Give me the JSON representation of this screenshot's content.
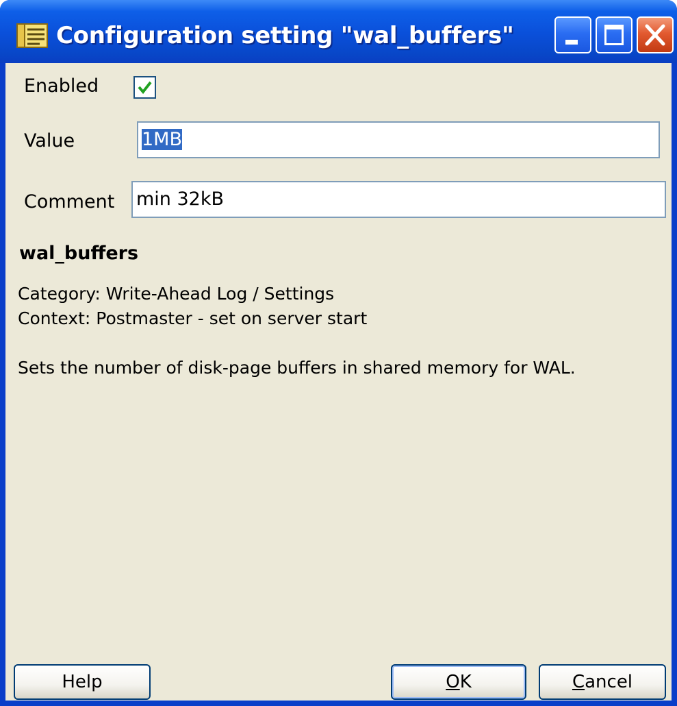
{
  "window": {
    "title": "Configuration setting \"wal_buffers\""
  },
  "form": {
    "enabled_label": "Enabled",
    "enabled_checked": true,
    "value_label": "Value",
    "value": "1MB",
    "comment_label": "Comment",
    "comment": "min 32kB"
  },
  "info": {
    "name": "wal_buffers",
    "category": "Category: Write-Ahead Log / Settings",
    "context": "Context: Postmaster - set on server start",
    "description": "Sets the number of disk-page buffers in shared memory for WAL."
  },
  "buttons": {
    "help": "Help",
    "ok_mnemonic": "O",
    "ok_rest": "K",
    "cancel_mnemonic": "C",
    "cancel_rest": "ancel"
  },
  "colors": {
    "titlebar": "#0a4fd9",
    "close_button": "#e25a30",
    "dialog_bg": "#ece9d8",
    "selection": "#316ac5",
    "checkmark": "#21a121"
  },
  "icons": {
    "app": "config-setting-icon",
    "minimize": "minimize-icon",
    "maximize": "maximize-icon",
    "close": "close-icon",
    "check": "checkmark-icon"
  }
}
